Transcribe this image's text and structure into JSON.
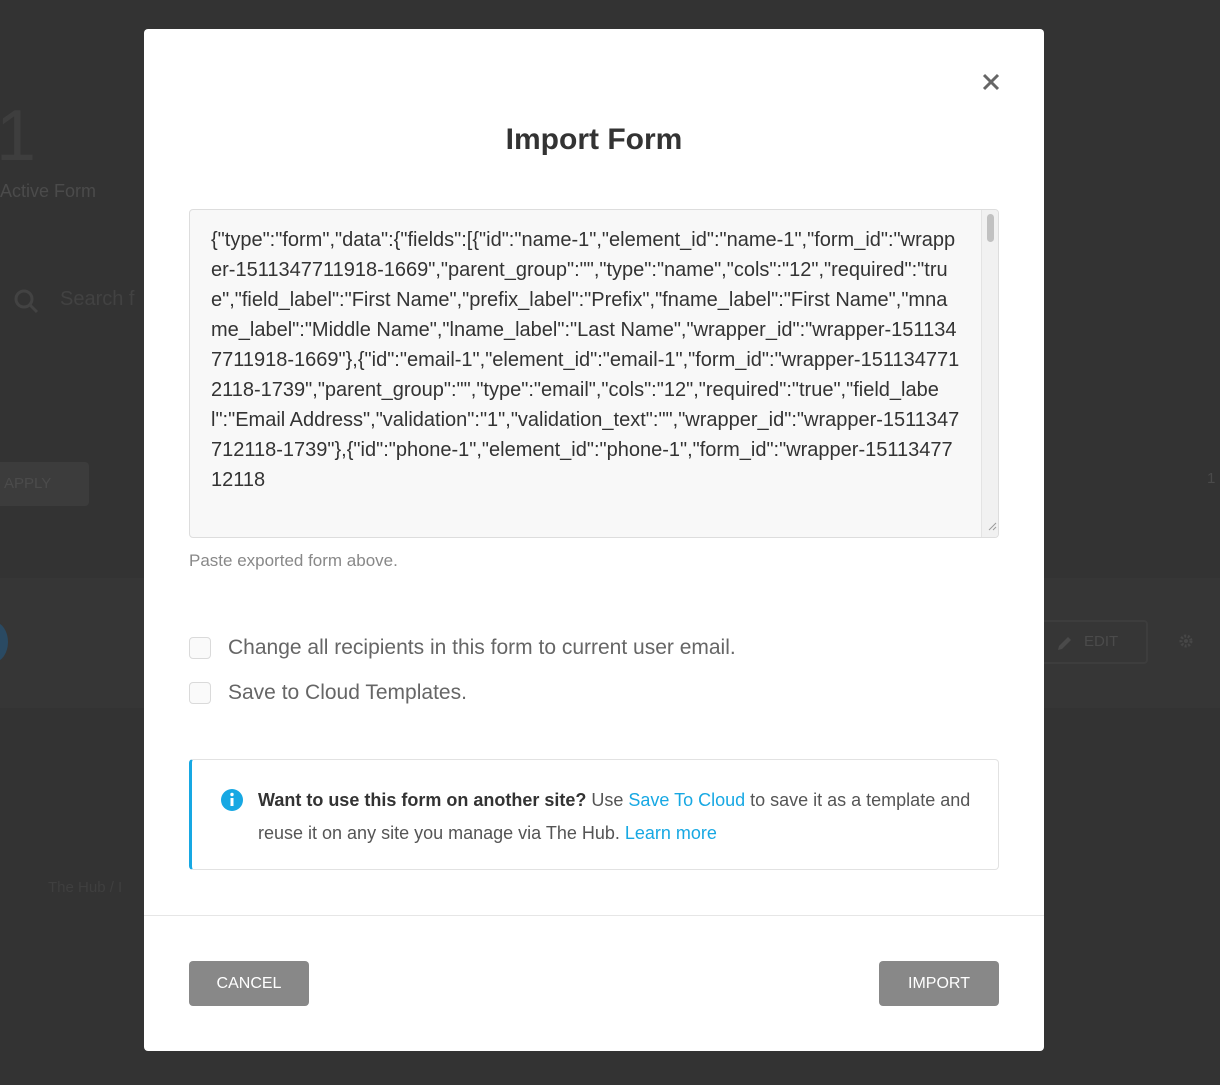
{
  "background": {
    "active_count": "1",
    "active_label": "Active Form",
    "search_placeholder": "Search f",
    "apply_label": "APPLY",
    "pagination": "1",
    "edit_label": "EDIT",
    "breadcrumb": "The Hub  /  I"
  },
  "modal": {
    "title": "Import Form",
    "form_export_json": "{\"type\":\"form\",\"data\":{\"fields\":[{\"id\":\"name-1\",\"element_id\":\"name-1\",\"form_id\":\"wrapper-1511347711918-1669\",\"parent_group\":\"\",\"type\":\"name\",\"cols\":\"12\",\"required\":\"true\",\"field_label\":\"First Name\",\"prefix_label\":\"Prefix\",\"fname_label\":\"First Name\",\"mname_label\":\"Middle Name\",\"lname_label\":\"Last Name\",\"wrapper_id\":\"wrapper-1511347711918-1669\"},{\"id\":\"email-1\",\"element_id\":\"email-1\",\"form_id\":\"wrapper-1511347712118-1739\",\"parent_group\":\"\",\"type\":\"email\",\"cols\":\"12\",\"required\":\"true\",\"field_label\":\"Email Address\",\"validation\":\"1\",\"validation_text\":\"\",\"wrapper_id\":\"wrapper-1511347712118-1739\"},{\"id\":\"phone-1\",\"element_id\":\"phone-1\",\"form_id\":\"wrapper-1511347712118",
    "helper_text": "Paste exported form above.",
    "change_recipients_label": "Change all recipients in this form to current user email.",
    "change_recipients_checked": false,
    "save_cloud_label": "Save to Cloud Templates.",
    "save_cloud_checked": false,
    "notice": {
      "heading": "Want to use this form on another site?",
      "text_1": " Use ",
      "link_save": "Save To Cloud",
      "text_2": " to save it as a template and reuse it on any site you manage via The Hub. ",
      "link_learn": "Learn more"
    },
    "cancel_label": "CANCEL",
    "import_label": "IMPORT"
  },
  "colors": {
    "overlay": "#333333",
    "accent": "#17a8e3",
    "button": "#888888"
  }
}
